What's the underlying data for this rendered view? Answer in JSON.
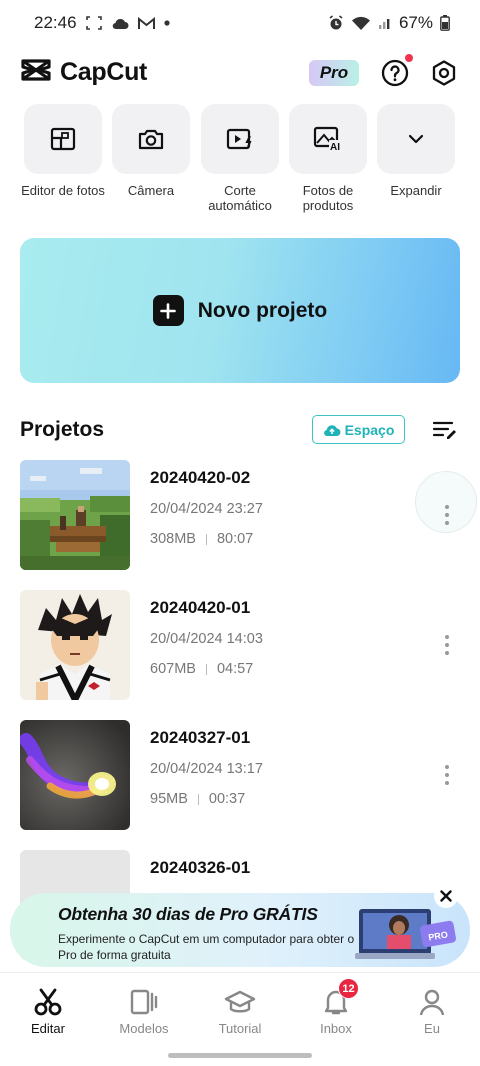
{
  "status_bar": {
    "time": "22:46",
    "battery": "67%",
    "icons": [
      "screenshot-icon",
      "cloud-icon",
      "gmail-icon",
      "dot-icon",
      "alarm-icon",
      "wifi-icon",
      "signal-icon",
      "battery-icon"
    ]
  },
  "header": {
    "app_name": "CapCut",
    "pro_label": "Pro",
    "icons": [
      "capcut-logo-icon",
      "help-icon",
      "settings-icon"
    ]
  },
  "tools": [
    {
      "label": "Editor de fotos",
      "icon": "photo-editor-icon"
    },
    {
      "label": "Câmera",
      "icon": "camera-icon"
    },
    {
      "label": "Corte automático",
      "icon": "auto-cut-icon"
    },
    {
      "label": "Fotos de produtos",
      "icon": "product-photo-ai-icon"
    },
    {
      "label": "Expandir",
      "icon": "chevron-down-icon"
    }
  ],
  "new_project": {
    "label": "Novo projeto"
  },
  "projects_section": {
    "title": "Projetos",
    "space_label": "Espaço"
  },
  "projects": [
    {
      "name": "20240420-02",
      "date": "20/04/2024 23:27",
      "size": "308MB",
      "duration": "80:07"
    },
    {
      "name": "20240420-01",
      "date": "20/04/2024 14:03",
      "size": "607MB",
      "duration": "04:57"
    },
    {
      "name": "20240327-01",
      "date": "20/04/2024 13:17",
      "size": "95MB",
      "duration": "00:37"
    },
    {
      "name": "20240326-01",
      "date": "",
      "size": "",
      "duration": ""
    }
  ],
  "promo": {
    "title": "Obtenha 30 dias de Pro GRÁTIS",
    "subtitle": "Experimente o CapCut em um computador para obter o Pro de forma gratuita",
    "art_badge": "PRO"
  },
  "bottom_nav": [
    {
      "label": "Editar",
      "icon": "scissors-icon",
      "active": true
    },
    {
      "label": "Modelos",
      "icon": "templates-icon",
      "active": false
    },
    {
      "label": "Tutorial",
      "icon": "graduation-cap-icon",
      "active": false
    },
    {
      "label": "Inbox",
      "icon": "bell-icon",
      "active": false
    },
    {
      "label": "Eu",
      "icon": "user-icon",
      "active": false
    }
  ],
  "inbox_badge": "12",
  "colors": {
    "accent_teal": "#1fb3b8",
    "badge_red": "#e8263f",
    "banner_start": "#a9ecef",
    "banner_end": "#67b8f4"
  }
}
